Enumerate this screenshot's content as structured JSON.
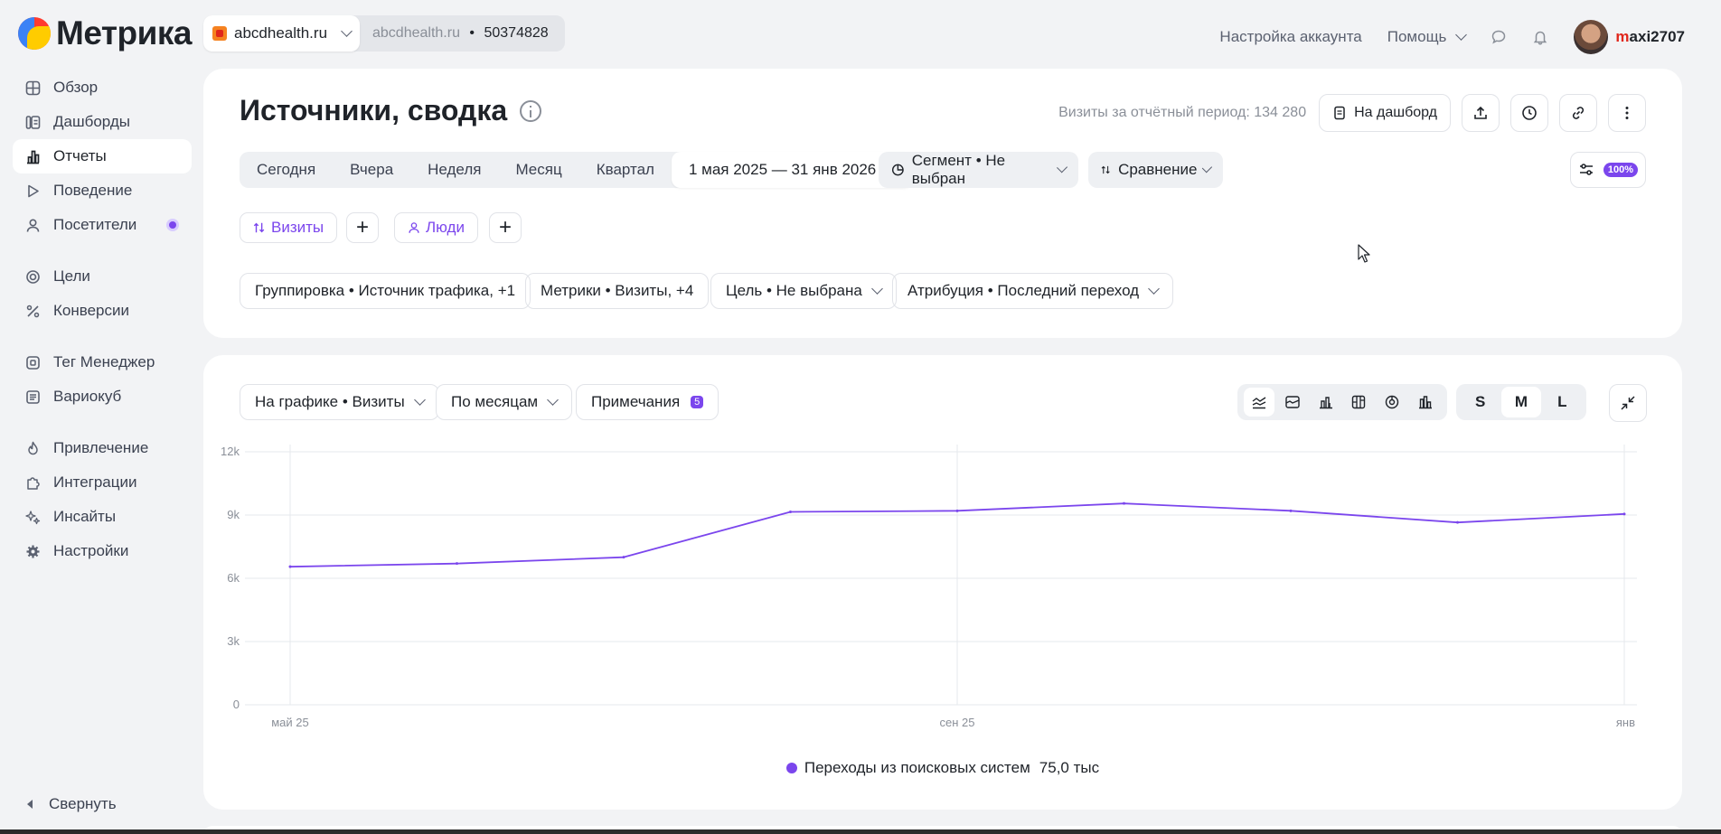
{
  "app": {
    "logo_text": "Метрика"
  },
  "site": {
    "domain": "abcdhealth.ru",
    "secondary_domain": "abcdhealth.ru",
    "separator": "•",
    "counter_id": "50374828"
  },
  "topnav": {
    "account_settings": "Настройка аккаунта",
    "help": "Помощь",
    "username_first": "m",
    "username_rest": "axi2707"
  },
  "sidebar": {
    "items": [
      {
        "label": "Обзор",
        "icon": "grid-icon"
      },
      {
        "label": "Дашборды",
        "icon": "dashboard-icon"
      },
      {
        "label": "Отчеты",
        "icon": "bar-chart-icon",
        "active": true
      },
      {
        "label": "Поведение",
        "icon": "play-icon"
      },
      {
        "label": "Посетители",
        "icon": "person-icon"
      },
      {
        "label": "Цели",
        "icon": "target-icon"
      },
      {
        "label": "Конверсии",
        "icon": "percent-icon"
      },
      {
        "label": "Тег Менеджер",
        "icon": "tag-icon"
      },
      {
        "label": "Вариокуб",
        "icon": "cube-icon"
      },
      {
        "label": "Привлечение",
        "icon": "flame-icon"
      },
      {
        "label": "Интеграции",
        "icon": "puzzle-icon"
      },
      {
        "label": "Инсайты",
        "icon": "sparkle-icon"
      },
      {
        "label": "Настройки",
        "icon": "gear-icon"
      }
    ],
    "collapse": "Свернуть"
  },
  "report": {
    "title": "Источники, сводка",
    "visits_total": "Визиты за отчётный период: 134 280",
    "to_dashboard": "На дашборд",
    "periods": [
      "Сегодня",
      "Вчера",
      "Неделя",
      "Месяц",
      "Квартал"
    ],
    "date_range": "1 мая 2025 — 31 янв 2026",
    "segment": "Сегмент • Не выбран",
    "compare": "Сравнение",
    "sampling": "100%",
    "chip_visits": "Визиты",
    "chip_people": "Люди",
    "filters": {
      "grouping": "Группировка • Источник трафика, +1",
      "metrics": "Метрики • Визиты, +4",
      "goal": "Цель • Не выбрана",
      "attribution": "Атрибуция • Последний переход"
    }
  },
  "chart_toolbar": {
    "on_chart": "На графике • Визиты",
    "by_period": "По месяцам",
    "notes": "Примечания",
    "notes_count": "5",
    "sizes": [
      "S",
      "M",
      "L"
    ],
    "active_size": "M"
  },
  "colors": {
    "accent": "#7b46ed",
    "grid": "#e6e8ec",
    "axis_text": "#8a8f98"
  },
  "chart_data": {
    "type": "line",
    "x": [
      "2025-05",
      "2025-06",
      "2025-07",
      "2025-08",
      "2025-09",
      "2025-10",
      "2025-11",
      "2025-12",
      "2026-01"
    ],
    "x_tick_labels": [
      {
        "at": "2025-05",
        "label": "май 25"
      },
      {
        "at": "2025-09",
        "label": "сен 25"
      },
      {
        "at": "2026-01",
        "label": "янв"
      }
    ],
    "y_ticks": [
      "0",
      "3k",
      "6k",
      "9k",
      "12k"
    ],
    "ylim": [
      0,
      12000
    ],
    "series": [
      {
        "name": "Переходы из поисковых систем",
        "total": "75,0 тыс",
        "values": [
          6550,
          6700,
          7000,
          9150,
          9200,
          9550,
          9200,
          8650,
          9050
        ]
      }
    ],
    "grid": true,
    "legend": "bottom-center"
  }
}
